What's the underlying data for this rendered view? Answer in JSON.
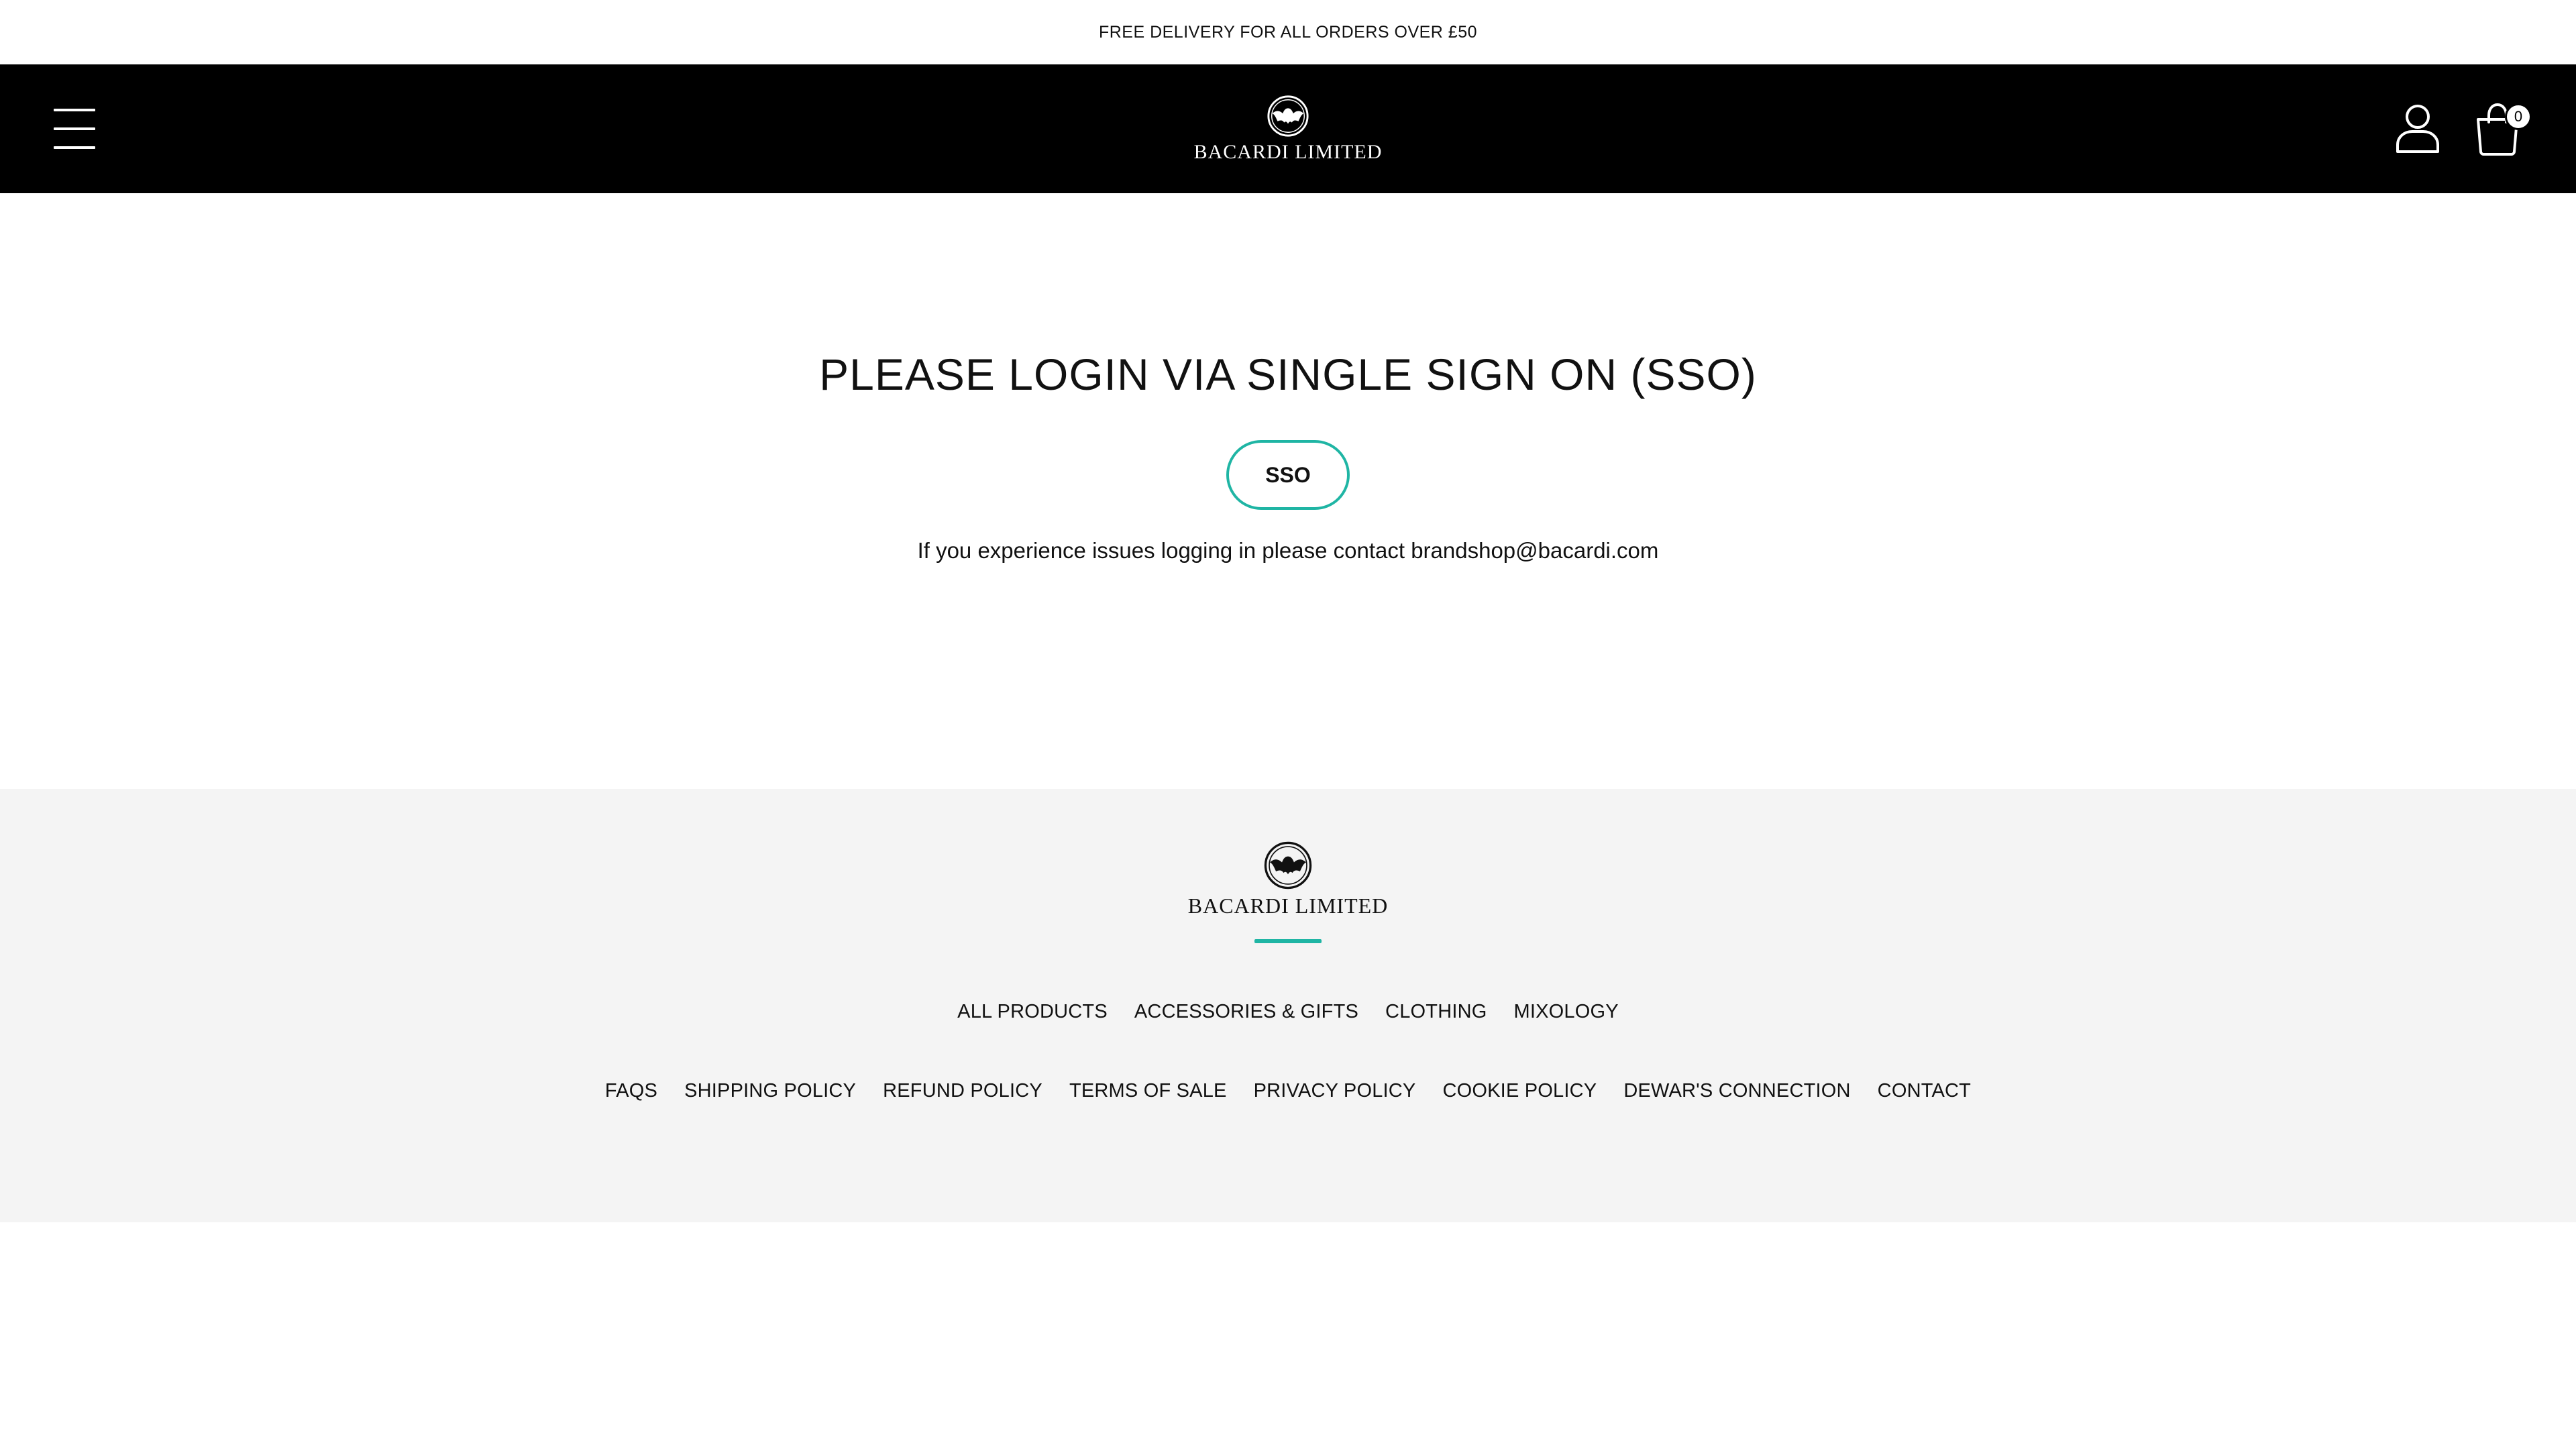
{
  "announcement": {
    "text": "FREE DELIVERY FOR ALL ORDERS OVER £50"
  },
  "header": {
    "logo_text": "BACARDI LIMITED",
    "cart_count": "0",
    "icons": {
      "menu": "hamburger-menu-icon",
      "account": "user-icon",
      "cart": "shopping-bag-icon",
      "logo": "bat-emblem-icon"
    }
  },
  "main": {
    "title": "PLEASE LOGIN VIA SINGLE SIGN ON (SSO)",
    "sso_button_label": "SSO",
    "help_text": "If you experience issues logging in please contact brandshop@bacardi.com"
  },
  "footer": {
    "logo_text": "BACARDI LIMITED",
    "primary_links": [
      "ALL PRODUCTS",
      "ACCESSORIES & GIFTS",
      "CLOTHING",
      "MIXOLOGY"
    ],
    "secondary_links": [
      "FAQS",
      "SHIPPING POLICY",
      "REFUND POLICY",
      "TERMS OF SALE",
      "PRIVACY POLICY",
      "COOKIE POLICY",
      "DEWAR'S CONNECTION",
      "CONTACT"
    ]
  },
  "colors": {
    "header_bg": "#000000",
    "accent": "#1fb5a4",
    "footer_bg": "#f4f4f4",
    "text": "#111111"
  }
}
